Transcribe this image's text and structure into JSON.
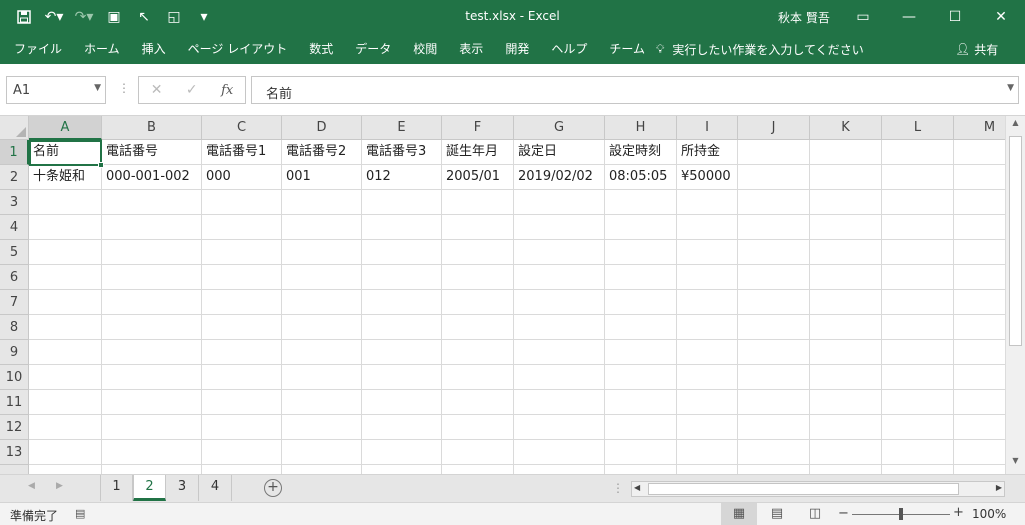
{
  "titlebar": {
    "filename": "test.xlsx",
    "separator": " - ",
    "app": "Excel",
    "user": "秋本 賢吾"
  },
  "ribbon": {
    "tabs": [
      "ファイル",
      "ホーム",
      "挿入",
      "ページ レイアウト",
      "数式",
      "データ",
      "校閲",
      "表示",
      "開発",
      "ヘルプ",
      "チーム"
    ],
    "tell_me": "実行したい作業を入力してください",
    "share": "共有"
  },
  "formula_bar": {
    "name_box": "A1",
    "content": "名前",
    "fx": "fx"
  },
  "columns": [
    "A",
    "B",
    "C",
    "D",
    "E",
    "F",
    "G",
    "H",
    "I",
    "J",
    "K",
    "L",
    "M"
  ],
  "rows": [
    "1",
    "2",
    "3",
    "4",
    "5",
    "6",
    "7",
    "8",
    "9",
    "10",
    "11",
    "12",
    "13"
  ],
  "cells": {
    "row1": [
      "名前",
      "電話番号",
      "電話番号1",
      "電話番号2",
      "電話番号3",
      "誕生年月",
      "設定日",
      "設定時刻",
      "所持金"
    ],
    "row2": [
      "十条姫和",
      "000-001-002",
      "000",
      "001",
      "012",
      "2005/01",
      "2019/02/02",
      "08:05:05",
      "¥50000"
    ]
  },
  "sheets": [
    "1",
    "2",
    "3",
    "4"
  ],
  "active_sheet": "2",
  "status": {
    "text": "準備完了",
    "zoom": "100%"
  },
  "colors": {
    "accent": "#217346"
  }
}
